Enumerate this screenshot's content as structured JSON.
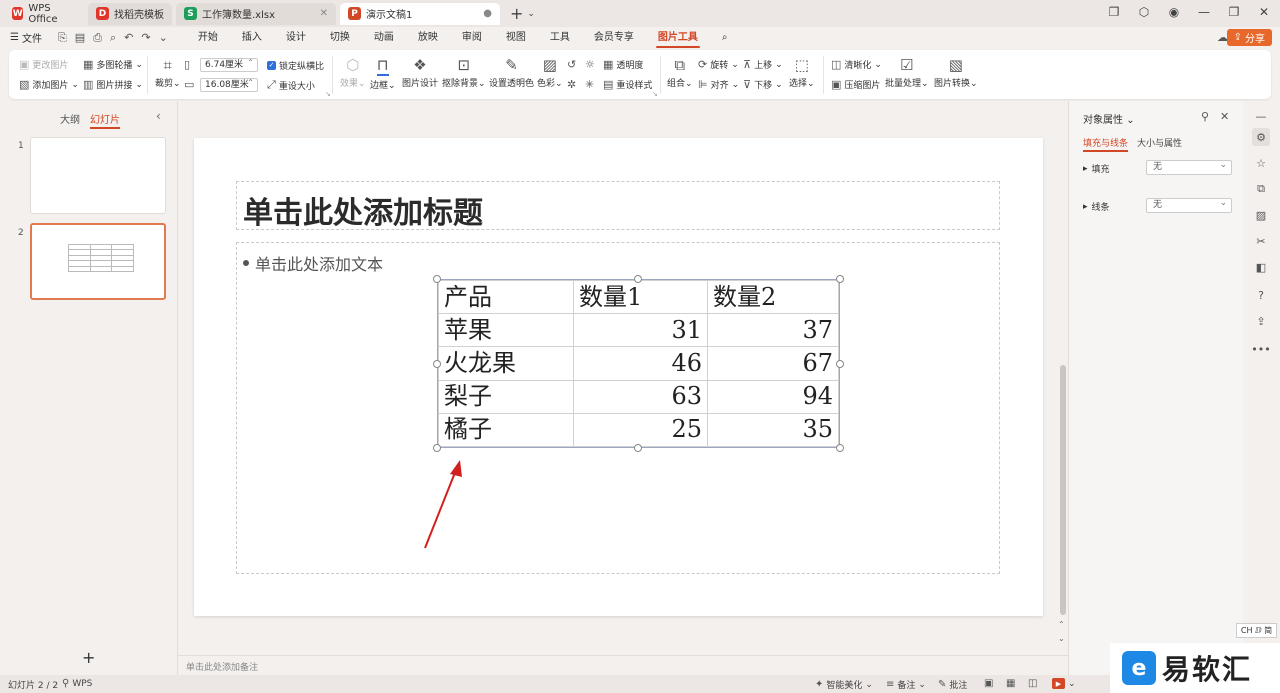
{
  "tabs": [
    {
      "label": "WPS Office",
      "logo": "W",
      "color": "#e0362c"
    },
    {
      "label": "找稻壳模板",
      "logo": "D",
      "color": "#e0362c"
    },
    {
      "label": "工作簿数量.xlsx",
      "logo": "S",
      "color": "#1e9e5a"
    },
    {
      "label": "演示文稿1",
      "logo": "P",
      "color": "#d24726"
    }
  ],
  "menubar": {
    "file": "文件",
    "items": [
      "开始",
      "插入",
      "设计",
      "切换",
      "动画",
      "放映",
      "审阅",
      "视图",
      "工具",
      "会员专享",
      "图片工具"
    ],
    "active": "图片工具",
    "share": "分享"
  },
  "ribbon": {
    "change_image": "更改图片",
    "multi_outline": "多图轮播",
    "add_image": "添加图片",
    "image_splice": "图片拼接",
    "crop": "裁剪",
    "width": "6.74厘米",
    "height": "16.08厘米",
    "lock_ratio": "锁定纵横比",
    "reset_size": "重设大小",
    "effects": "效果",
    "border": "边框",
    "image_design": "图片设计",
    "remove_bg": "抠除背景",
    "set_transparent": "设置透明色",
    "color": "色彩",
    "transparency": "透明度",
    "reset_style": "重设样式",
    "group": "组合",
    "rotate": "旋转",
    "align": "对齐",
    "bring_up": "上移",
    "send_down": "下移",
    "select": "选择",
    "sharpen": "清晰化",
    "compress": "压缩图片",
    "batch": "批量处理",
    "convert": "图片转换"
  },
  "left_panel": {
    "outline_tab": "大纲",
    "slides_tab": "幻灯片",
    "slide_numbers": [
      "1",
      "2"
    ]
  },
  "slide": {
    "title_placeholder": "单击此处添加标题",
    "body_placeholder": "单击此处添加文本",
    "table": {
      "headers": [
        "产品",
        "数量1",
        "数量2"
      ],
      "rows": [
        [
          "苹果",
          "31",
          "37"
        ],
        [
          "火龙果",
          "46",
          "67"
        ],
        [
          "梨子",
          "63",
          "94"
        ],
        [
          "橘子",
          "25",
          "35"
        ]
      ]
    }
  },
  "notes_placeholder": "单击此处添加备注",
  "right_panel": {
    "title": "对象属性",
    "tab_fill": "填充与线条",
    "tab_size": "大小与属性",
    "fill_label": "填充",
    "fill_value": "无",
    "line_label": "线条",
    "line_value": "无"
  },
  "ime_badge": "CH ⅅ 简",
  "status": {
    "slide_count": "幻灯片 2 / 2",
    "theme": "WPS",
    "beautify": "智能美化",
    "notes": "备注",
    "comments": "批注"
  },
  "watermark": {
    "logo": "e",
    "text": "易软汇"
  },
  "colors": {
    "accent": "#d24726",
    "share": "#e8672a",
    "checkbox": "#2f6fdb",
    "arrow": "#d21f1f"
  }
}
